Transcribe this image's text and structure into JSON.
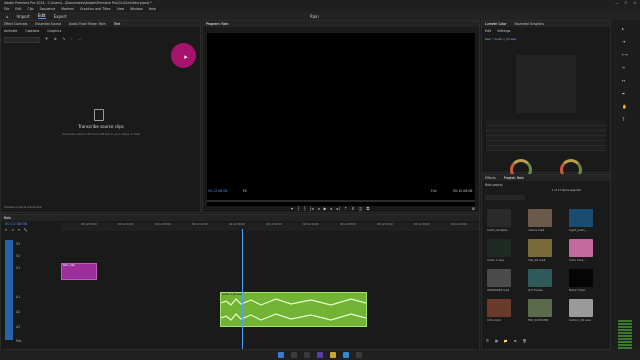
{
  "window": {
    "title": "Adobe Premiere Pro 2024 - C:\\Users\\...\\Documents\\Adobe\\Premiere Pro\\24.0\\Untitled.prproj *"
  },
  "menu": [
    "File",
    "Edit",
    "Clip",
    "Sequence",
    "Markers",
    "Graphics and Titles",
    "View",
    "Window",
    "Help"
  ],
  "workspace": {
    "tabs": [
      "Import",
      "Edit",
      "Export"
    ],
    "active": "Edit",
    "center_label": "Rain"
  },
  "source_panel": {
    "tabs": [
      "Effect Controls",
      "Essential Sound",
      "Audio Track Mixer: Rain",
      "Text",
      "Source: (no clips)"
    ],
    "subtabs": [
      "Animate",
      "Captions",
      "Graphics"
    ],
    "empty_title": "Transcribe source clips",
    "empty_hint": "Transcribe video to find and edit text in your videos, in time",
    "bottom_link": "Choose a clip to transcribe"
  },
  "program_panel": {
    "tab": "Program: Rain",
    "timecode_left": "00:12:08:08",
    "fit_label": "Fit",
    "full_label": "Full",
    "timecode_right": "00:12:08:08"
  },
  "lumetri_panel": {
    "tabs": [
      "Lumetri Color",
      "Essential Graphics"
    ],
    "subtabs": [
      "Edit",
      "Settings"
    ],
    "clip_label": "Rain * Audio 1_01.wav"
  },
  "project_panel": {
    "tabs": [
      "Effects",
      "Project: Rain"
    ],
    "bin_label": "Rain.prproj",
    "items_count": "1 of 17 items selected",
    "items": [
      {
        "name": "Audio_Sample..."
      },
      {
        "name": "nature.mp4"
      },
      {
        "name": "Light_leaks_..."
      },
      {
        "name": "Audio 1.wav"
      },
      {
        "name": "Clip_02.mp4"
      },
      {
        "name": "Color bars..."
      },
      {
        "name": "GOPR0038.mp4"
      },
      {
        "name": "LUT Folder..."
      },
      {
        "name": "Black Video"
      },
      {
        "name": "Intro.mp4"
      },
      {
        "name": "MVI_0245.MP4"
      },
      {
        "name": "Audio 1_01.wav"
      }
    ]
  },
  "timeline": {
    "tab": "Rain",
    "timecode": "00:12:08:08",
    "ruler": [
      "00:12:00:00",
      "00:12:04:00",
      "00:12:08:00",
      "00:12:12:00",
      "00:12:16:00",
      "00:12:20:00",
      "00:12:24:00",
      "00:12:28:00",
      "00:12:32:00",
      "00:12:36:00",
      "00:12:40:00"
    ],
    "tracks": [
      "V3",
      "V2",
      "V1",
      "A1",
      "A2",
      "A3",
      "Mix"
    ],
    "video_clip": "Rain_Clip",
    "audio_clip": "Audio 1_01.wav"
  },
  "colors": {
    "accent": "#4e8ef7",
    "video_clip": "#9c2f9a",
    "audio_clip": "#72b334",
    "cursor_highlight": "#c0137b"
  }
}
